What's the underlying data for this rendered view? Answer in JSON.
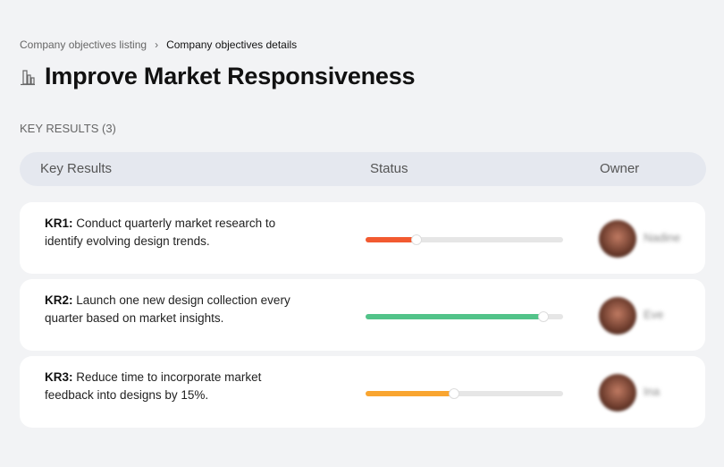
{
  "breadcrumb": {
    "parent": "Company objectives listing",
    "separator": "›",
    "current": "Company objectives details"
  },
  "page": {
    "title": "Improve Market Responsiveness",
    "icon": "building-chart-icon"
  },
  "section_label": "KEY RESULTS (3)",
  "table": {
    "headers": [
      "Key Results",
      "Status",
      "Owner"
    ],
    "rows": [
      {
        "id": "KR1:",
        "text": "Conduct quarterly market research to identify evolving design trends.",
        "progress": 26,
        "color": "#f25a30",
        "owner": "Nadine"
      },
      {
        "id": "KR2:",
        "text": "Launch one new design collection every quarter based on market insights.",
        "progress": 90,
        "color": "#52c389",
        "owner": "Eve"
      },
      {
        "id": "KR3:",
        "text": "Reduce time to incorporate market feedback into designs by 15%.",
        "progress": 45,
        "color": "#f9a530",
        "owner": "Ina"
      }
    ]
  }
}
